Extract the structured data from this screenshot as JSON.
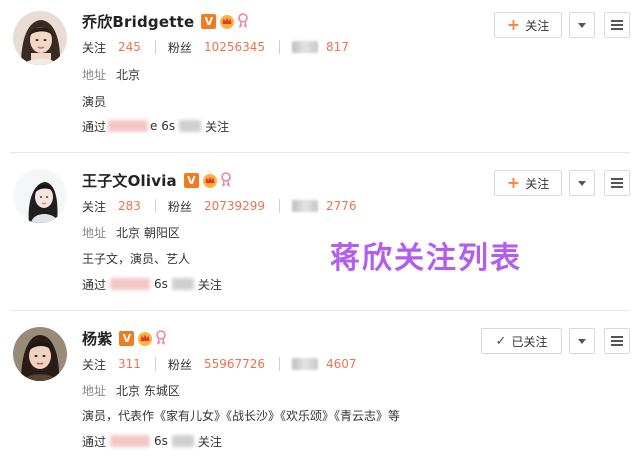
{
  "users": [
    {
      "name": "乔欣Bridgette",
      "verified_badge": "V",
      "follow_label": "关注",
      "follows_label": "关注",
      "follows_count": "245",
      "fans_label": "粉丝",
      "fans_count": "10256345",
      "posts_count": "817",
      "location_label": "地址",
      "location": "北京",
      "bio": "演员",
      "via_prefix": "通过",
      "via_mid": "e 6s",
      "via_suffix": "关注"
    },
    {
      "name": "王子文Olivia",
      "verified_badge": "V",
      "follow_label": "关注",
      "follows_label": "关注",
      "follows_count": "283",
      "fans_label": "粉丝",
      "fans_count": "20739299",
      "posts_count": "2776",
      "location_label": "地址",
      "location": "北京 朝阳区",
      "bio": "王子文，演员、艺人",
      "via_prefix": "通过",
      "via_mid": "6s",
      "via_suffix": "关注"
    },
    {
      "name": "杨紫",
      "verified_badge": "V",
      "follow_label": "已关注",
      "follows_label": "关注",
      "follows_count": "311",
      "fans_label": "粉丝",
      "fans_count": "55967726",
      "posts_count": "4607",
      "location_label": "地址",
      "location": "北京 东城区",
      "bio": "演员，代表作《家有儿女》《战长沙》《欢乐颂》《青云志》等",
      "via_prefix": "通过",
      "via_mid": "6s",
      "via_suffix": "关注"
    }
  ],
  "overlay_text": "蒋欣关注列表",
  "icons": {
    "follow_plus": "plus-icon",
    "followed_check": "check-icon",
    "dropdown": "chevron-down-icon",
    "more": "menu-icon",
    "crown": "crown-icon",
    "ribbon": "ribbon-icon"
  },
  "colors": {
    "accent": "#eb7350",
    "plus": "#ff8140",
    "verified": "#f07c1f",
    "overlay": "#b35cf0"
  }
}
